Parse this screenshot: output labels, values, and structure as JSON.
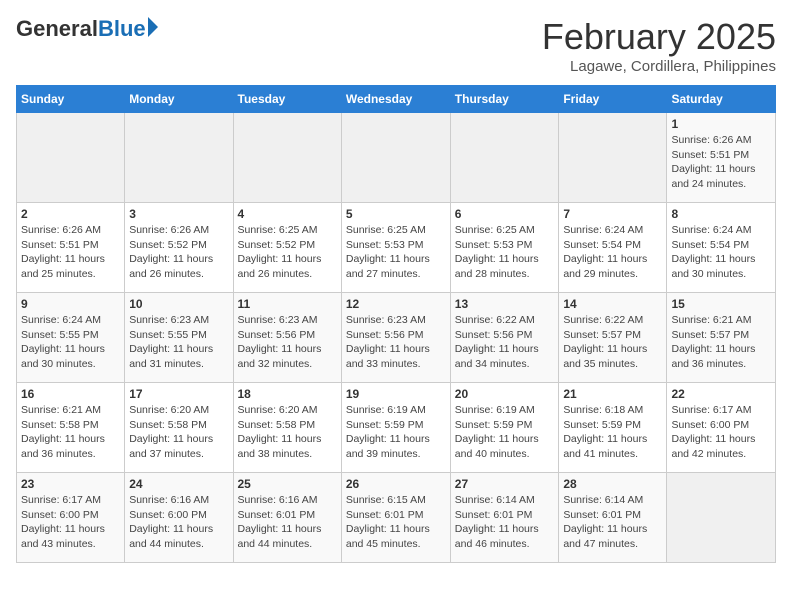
{
  "header": {
    "logo": {
      "general": "General",
      "blue": "Blue"
    },
    "title": "February 2025",
    "location": "Lagawe, Cordillera, Philippines"
  },
  "calendar": {
    "days_of_week": [
      "Sunday",
      "Monday",
      "Tuesday",
      "Wednesday",
      "Thursday",
      "Friday",
      "Saturday"
    ],
    "weeks": [
      [
        {
          "day": "",
          "info": ""
        },
        {
          "day": "",
          "info": ""
        },
        {
          "day": "",
          "info": ""
        },
        {
          "day": "",
          "info": ""
        },
        {
          "day": "",
          "info": ""
        },
        {
          "day": "",
          "info": ""
        },
        {
          "day": "1",
          "info": "Sunrise: 6:26 AM\nSunset: 5:51 PM\nDaylight: 11 hours and 24 minutes."
        }
      ],
      [
        {
          "day": "2",
          "info": "Sunrise: 6:26 AM\nSunset: 5:51 PM\nDaylight: 11 hours and 25 minutes."
        },
        {
          "day": "3",
          "info": "Sunrise: 6:26 AM\nSunset: 5:52 PM\nDaylight: 11 hours and 26 minutes."
        },
        {
          "day": "4",
          "info": "Sunrise: 6:25 AM\nSunset: 5:52 PM\nDaylight: 11 hours and 26 minutes."
        },
        {
          "day": "5",
          "info": "Sunrise: 6:25 AM\nSunset: 5:53 PM\nDaylight: 11 hours and 27 minutes."
        },
        {
          "day": "6",
          "info": "Sunrise: 6:25 AM\nSunset: 5:53 PM\nDaylight: 11 hours and 28 minutes."
        },
        {
          "day": "7",
          "info": "Sunrise: 6:24 AM\nSunset: 5:54 PM\nDaylight: 11 hours and 29 minutes."
        },
        {
          "day": "8",
          "info": "Sunrise: 6:24 AM\nSunset: 5:54 PM\nDaylight: 11 hours and 30 minutes."
        }
      ],
      [
        {
          "day": "9",
          "info": "Sunrise: 6:24 AM\nSunset: 5:55 PM\nDaylight: 11 hours and 30 minutes."
        },
        {
          "day": "10",
          "info": "Sunrise: 6:23 AM\nSunset: 5:55 PM\nDaylight: 11 hours and 31 minutes."
        },
        {
          "day": "11",
          "info": "Sunrise: 6:23 AM\nSunset: 5:56 PM\nDaylight: 11 hours and 32 minutes."
        },
        {
          "day": "12",
          "info": "Sunrise: 6:23 AM\nSunset: 5:56 PM\nDaylight: 11 hours and 33 minutes."
        },
        {
          "day": "13",
          "info": "Sunrise: 6:22 AM\nSunset: 5:56 PM\nDaylight: 11 hours and 34 minutes."
        },
        {
          "day": "14",
          "info": "Sunrise: 6:22 AM\nSunset: 5:57 PM\nDaylight: 11 hours and 35 minutes."
        },
        {
          "day": "15",
          "info": "Sunrise: 6:21 AM\nSunset: 5:57 PM\nDaylight: 11 hours and 36 minutes."
        }
      ],
      [
        {
          "day": "16",
          "info": "Sunrise: 6:21 AM\nSunset: 5:58 PM\nDaylight: 11 hours and 36 minutes."
        },
        {
          "day": "17",
          "info": "Sunrise: 6:20 AM\nSunset: 5:58 PM\nDaylight: 11 hours and 37 minutes."
        },
        {
          "day": "18",
          "info": "Sunrise: 6:20 AM\nSunset: 5:58 PM\nDaylight: 11 hours and 38 minutes."
        },
        {
          "day": "19",
          "info": "Sunrise: 6:19 AM\nSunset: 5:59 PM\nDaylight: 11 hours and 39 minutes."
        },
        {
          "day": "20",
          "info": "Sunrise: 6:19 AM\nSunset: 5:59 PM\nDaylight: 11 hours and 40 minutes."
        },
        {
          "day": "21",
          "info": "Sunrise: 6:18 AM\nSunset: 5:59 PM\nDaylight: 11 hours and 41 minutes."
        },
        {
          "day": "22",
          "info": "Sunrise: 6:17 AM\nSunset: 6:00 PM\nDaylight: 11 hours and 42 minutes."
        }
      ],
      [
        {
          "day": "23",
          "info": "Sunrise: 6:17 AM\nSunset: 6:00 PM\nDaylight: 11 hours and 43 minutes."
        },
        {
          "day": "24",
          "info": "Sunrise: 6:16 AM\nSunset: 6:00 PM\nDaylight: 11 hours and 44 minutes."
        },
        {
          "day": "25",
          "info": "Sunrise: 6:16 AM\nSunset: 6:01 PM\nDaylight: 11 hours and 44 minutes."
        },
        {
          "day": "26",
          "info": "Sunrise: 6:15 AM\nSunset: 6:01 PM\nDaylight: 11 hours and 45 minutes."
        },
        {
          "day": "27",
          "info": "Sunrise: 6:14 AM\nSunset: 6:01 PM\nDaylight: 11 hours and 46 minutes."
        },
        {
          "day": "28",
          "info": "Sunrise: 6:14 AM\nSunset: 6:01 PM\nDaylight: 11 hours and 47 minutes."
        },
        {
          "day": "",
          "info": ""
        }
      ]
    ]
  }
}
